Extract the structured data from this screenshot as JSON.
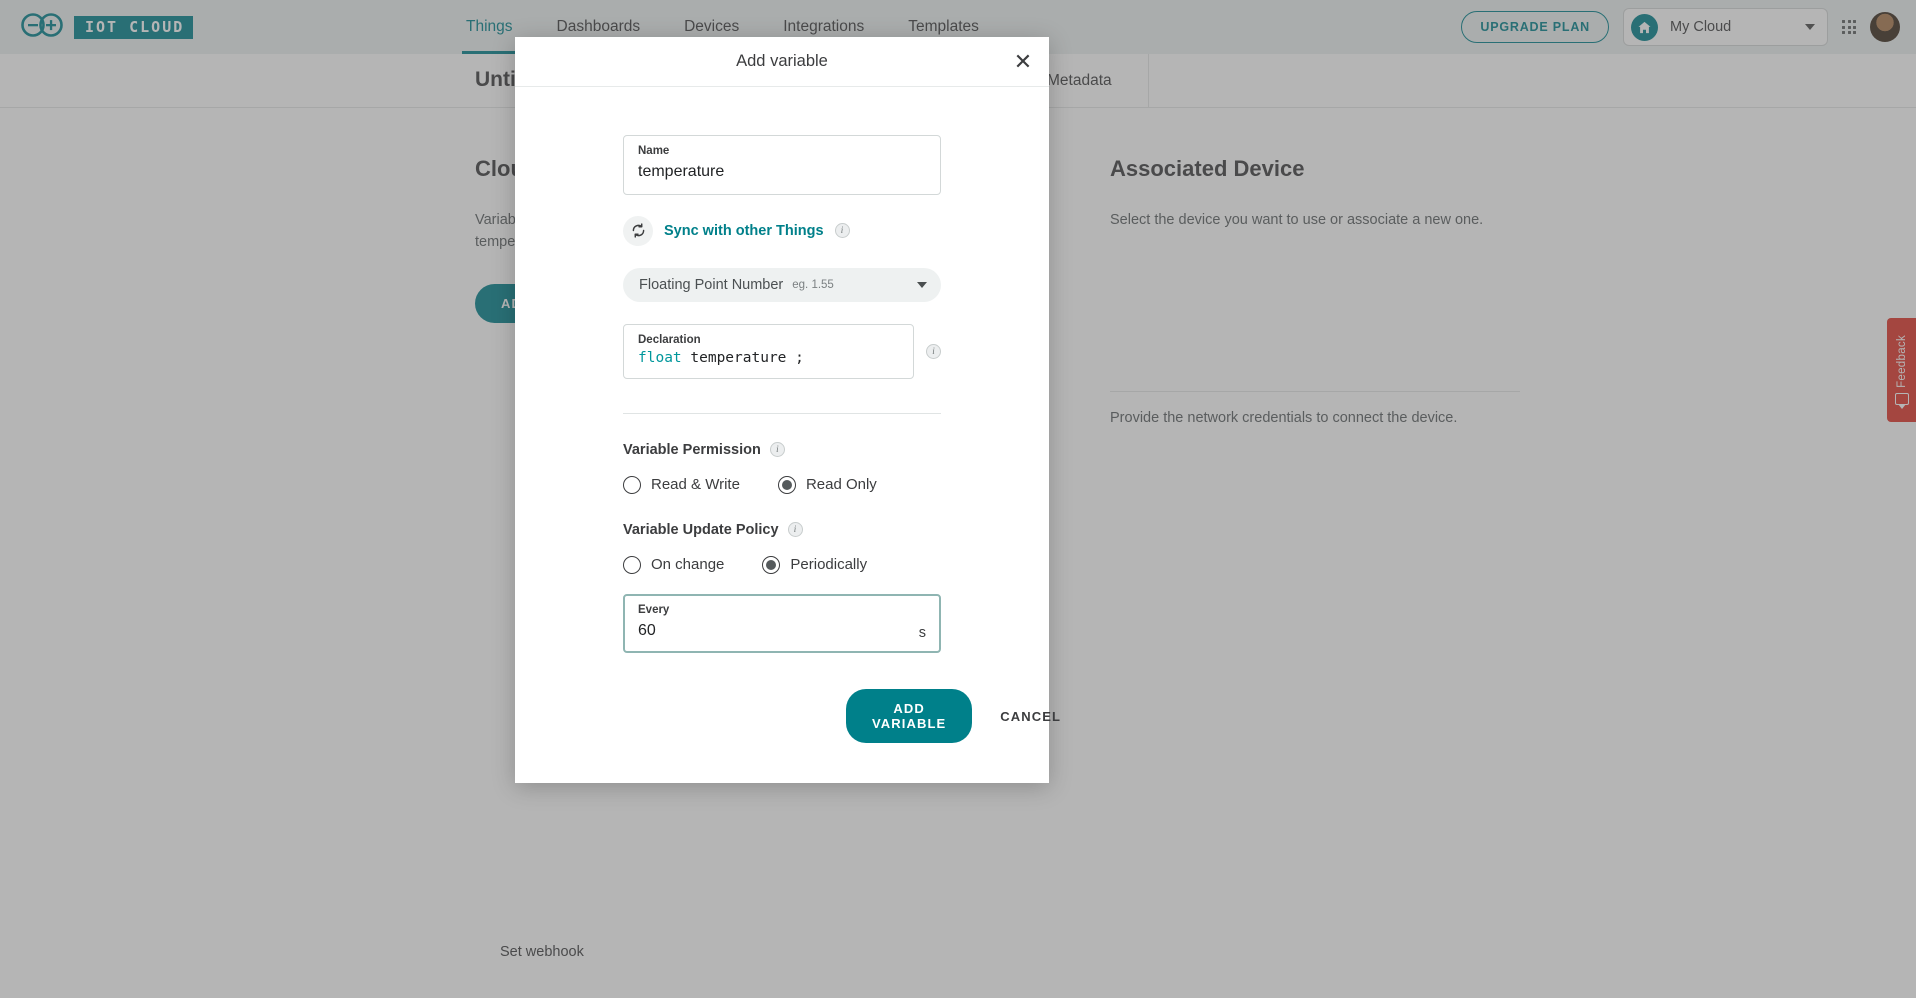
{
  "navbar": {
    "brand": "IOT CLOUD",
    "links": [
      {
        "label": "Things",
        "active": true
      },
      {
        "label": "Dashboards",
        "active": false
      },
      {
        "label": "Devices",
        "active": false
      },
      {
        "label": "Integrations",
        "active": false
      },
      {
        "label": "Templates",
        "active": false
      }
    ],
    "upgrade_label": "UPGRADE PLAN",
    "cloud_name": "My Cloud"
  },
  "thing": {
    "title": "Untitled",
    "tab_metadata": "Metadata"
  },
  "main": {
    "left": {
      "heading": "Cloud Variables",
      "paragraph": "Variables are what you want to read or control. For example, the temperature or a smart light switch.",
      "add_variable_label": "ADD VARIABLE"
    },
    "right": {
      "heading": "Associated Device",
      "paragraph": "Select the device you want to use or associate a new one.",
      "network_paragraph": "Provide the network credentials to connect the device."
    },
    "set_webhook_label": "Set webhook"
  },
  "feedback": {
    "label": "Feedback"
  },
  "modal": {
    "title": "Add variable",
    "close_label": "✕",
    "name_field": {
      "label": "Name",
      "value": "temperature"
    },
    "sync": {
      "label": "Sync with other Things",
      "icon": "sync-icon",
      "info": "i"
    },
    "type_select": {
      "name": "Floating Point Number",
      "example": "eg. 1.55"
    },
    "declaration": {
      "label": "Declaration",
      "type_token": "float",
      "rest_token": " temperature ;",
      "info": "i"
    },
    "permission": {
      "title": "Variable Permission",
      "info": "i",
      "options": [
        {
          "label": "Read & Write",
          "selected": false
        },
        {
          "label": "Read Only",
          "selected": true
        }
      ]
    },
    "update_policy": {
      "title": "Variable Update Policy",
      "info": "i",
      "options": [
        {
          "label": "On change",
          "selected": false
        },
        {
          "label": "Periodically",
          "selected": true
        }
      ]
    },
    "every_field": {
      "label": "Every",
      "value": "60",
      "unit": "s"
    },
    "actions": {
      "submit_label": "ADD VARIABLE",
      "cancel_label": "CANCEL"
    }
  },
  "colors": {
    "accent": "#00808a",
    "code_type": "#00979c",
    "feedback": "#e0352b",
    "focus_border": "#8fb5b2"
  }
}
